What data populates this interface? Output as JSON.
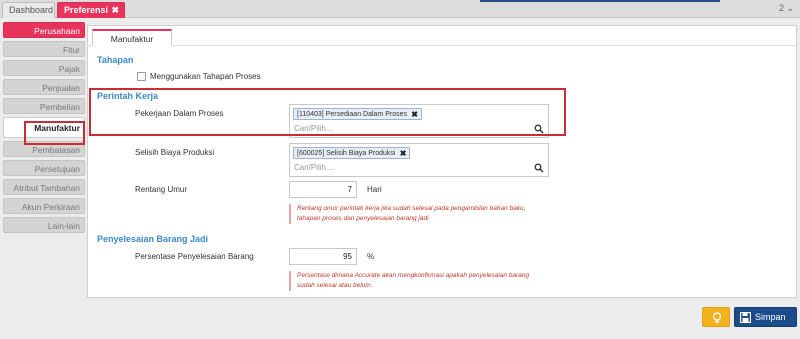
{
  "top_tabs": {
    "dashboard": "Dashboard",
    "preferensi": "Preferensi",
    "close_symbol": "✖",
    "window_number": "2 ⌄"
  },
  "sidenav": {
    "items": [
      "Perusahaan",
      "Fitur",
      "Pajak",
      "Penjualan",
      "Pembelian",
      "Manufaktur",
      "Pembatasan",
      "Persetujuan",
      "Atribut Tambahan",
      "Akun Perkiraan",
      "Lain-lain"
    ],
    "active_index": 5
  },
  "subtab": {
    "label": "Manufaktur"
  },
  "tahapan": {
    "title": "Tahapan",
    "checkbox_label": "Menggunakan Tahapan Proses",
    "checked": false
  },
  "perintah_kerja": {
    "title": "Perintah Kerja",
    "pekerjaan_label": "Pekerjaan Dalam Proses",
    "pekerjaan_chip": "[110403] Persediaan Dalam Proses",
    "pekerjaan_placeholder": "Cari/Pilih...",
    "selisih_label": "Selisih Biaya Produksi",
    "selisih_chip": "[600025] Selisih Biaya Produksi",
    "selisih_placeholder": "Cari/Pilih...",
    "rentang_label": "Rentang Umur",
    "rentang_value": "7",
    "rentang_unit": "Hari",
    "rentang_note_line1": "Rentang umur perintah kerja jika sudah selesai pada pengambilan bahan baku,",
    "rentang_note_line2": "tahapan proses dan penyelesaian barang jadi"
  },
  "penyelesaian": {
    "title": "Penyelesaian Barang Jadi",
    "persentase_label": "Persentase Penyelesaian Barang",
    "persentase_value": "95",
    "persentase_unit": "%",
    "note_line1": "Persentase dimana Accurate akan mengkonfirmasi apakah penyelesaian barang",
    "note_line2": "sudah selesai atau belum."
  },
  "buttons": {
    "save_label": "Simpan"
  },
  "colors": {
    "accent_pink": "#e8335c",
    "section_blue": "#3a89c9",
    "highlight_red": "#cc2b35",
    "save_navy": "#1c4b8a",
    "bulb_yellow": "#f4b21e"
  },
  "icons": {
    "close": "close-icon",
    "search": "search-icon",
    "save": "floppy-disk-icon",
    "bulb": "lightbulb-icon"
  }
}
